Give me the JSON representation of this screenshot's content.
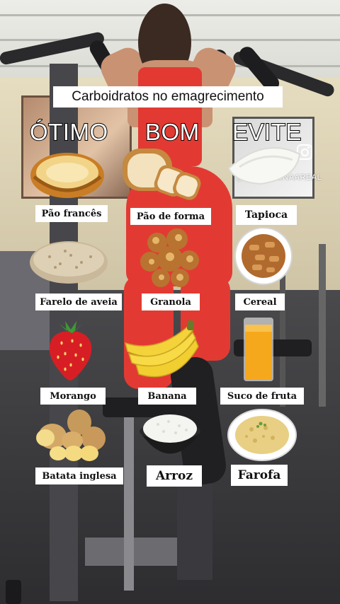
{
  "title": "Carboidratos no emagrecimento",
  "columns": [
    "ÓTIMO",
    "BOM",
    "EVITE"
  ],
  "social_handle": "@NUTRI.LUNAAREAL",
  "icons": [
    "instagram-icon"
  ],
  "rows": [
    [
      "Pão francês",
      "Pão de forma",
      "Tapioca"
    ],
    [
      "Farelo de aveia",
      "Granola",
      "Cereal"
    ],
    [
      "Morango",
      "Banana",
      "Suco de fruta"
    ],
    [
      "Batata inglesa",
      "Arroz",
      "Farofa"
    ]
  ],
  "colors": {
    "label_bg": "#ffffff",
    "heading_fill": "#ffffff",
    "heading_outline": "#000000"
  }
}
